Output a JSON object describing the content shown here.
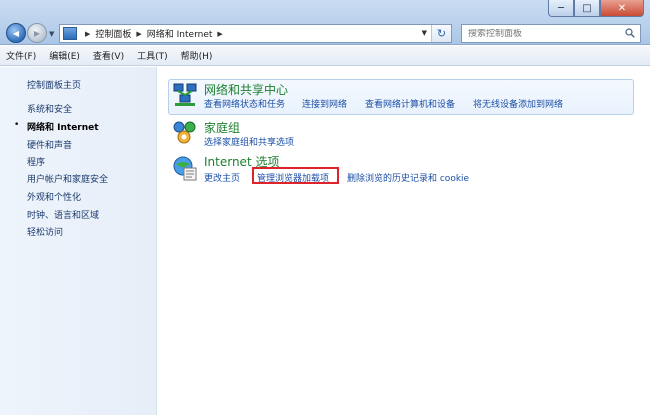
{
  "window": {
    "controls": {
      "minimize": "─",
      "maximize": "□",
      "close": "✕"
    }
  },
  "nav": {
    "back": "◀",
    "forward": "▶",
    "dropdown": "▼"
  },
  "address": {
    "crumbs": [
      "控制面板",
      "网络和 Internet"
    ],
    "separator": "▶",
    "dropdown": "▼",
    "refresh": "↻"
  },
  "search": {
    "placeholder": "搜索控制面板"
  },
  "menu": [
    "文件(F)",
    "编辑(E)",
    "查看(V)",
    "工具(T)",
    "帮助(H)"
  ],
  "sidebar": {
    "items": [
      {
        "label": "控制面板主页",
        "current": false
      },
      {
        "label": "系统和安全",
        "current": false
      },
      {
        "label": "网络和 Internet",
        "current": true
      },
      {
        "label": "硬件和声音",
        "current": false
      },
      {
        "label": "程序",
        "current": false
      },
      {
        "label": "用户帐户和家庭安全",
        "current": false
      },
      {
        "label": "外观和个性化",
        "current": false
      },
      {
        "label": "时钟、语言和区域",
        "current": false
      },
      {
        "label": "轻松访问",
        "current": false
      }
    ],
    "bullet": "•"
  },
  "categories": [
    {
      "title": "网络和共享中心",
      "links": [
        "查看网络状态和任务",
        "连接到网络",
        "查看网络计算机和设备",
        "将无线设备添加到网络"
      ]
    },
    {
      "title": "家庭组",
      "links": [
        "选择家庭组和共享选项"
      ]
    },
    {
      "title": "Internet 选项",
      "links": [
        "更改主页",
        "管理浏览器加载项",
        "删除浏览的历史记录和 cookie"
      ]
    }
  ],
  "colors": {
    "link": "#1b4fa6",
    "category_title": "#1d7f2f",
    "highlight": "#e0222a"
  }
}
